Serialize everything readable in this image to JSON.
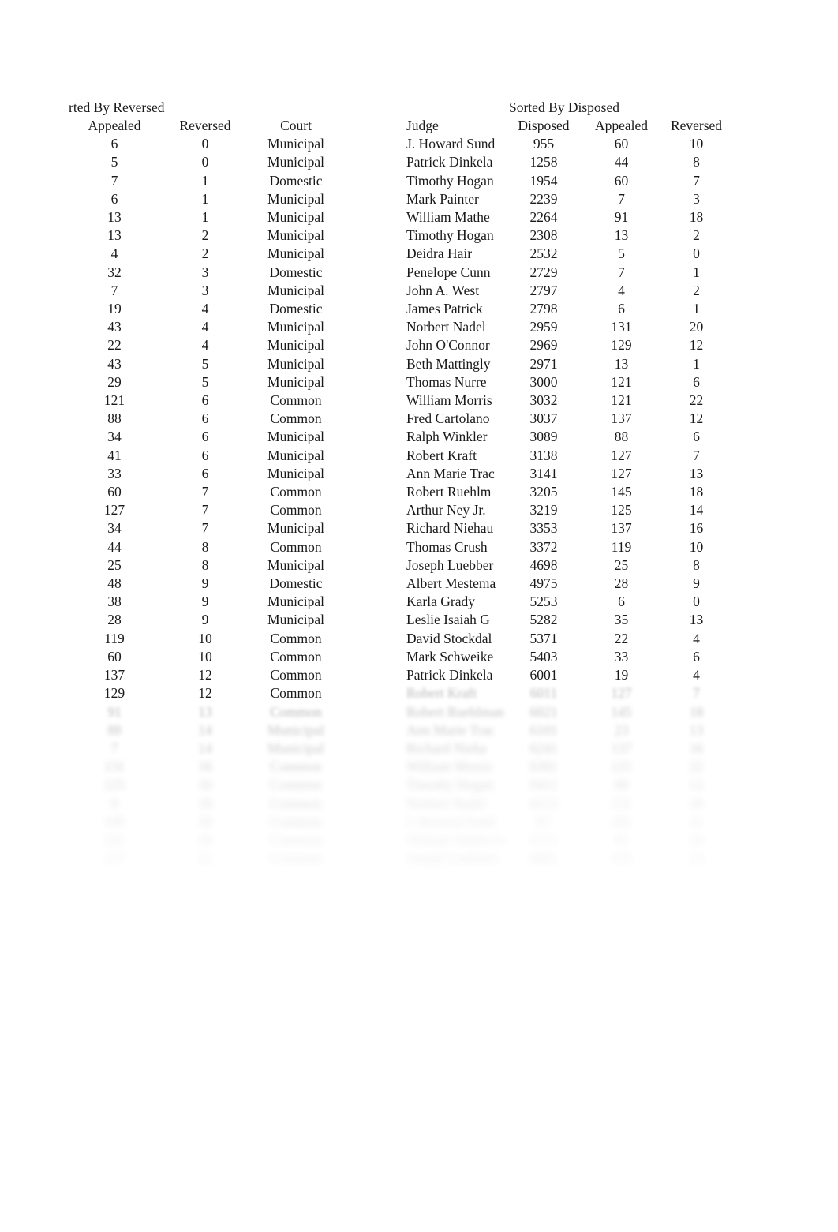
{
  "page": {
    "background_color": "#ffffff",
    "text_color": "#1a1a1a"
  },
  "left_table": {
    "title": "rted By Reversed",
    "columns": [
      "Appealed",
      "Reversed",
      "Court"
    ],
    "rows": [
      [
        "6",
        "0",
        "Municipal"
      ],
      [
        "5",
        "0",
        "Municipal"
      ],
      [
        "7",
        "1",
        "Domestic"
      ],
      [
        "6",
        "1",
        "Municipal"
      ],
      [
        "13",
        "1",
        "Municipal"
      ],
      [
        "13",
        "2",
        "Municipal"
      ],
      [
        "4",
        "2",
        "Municipal"
      ],
      [
        "32",
        "3",
        "Domestic"
      ],
      [
        "7",
        "3",
        "Municipal"
      ],
      [
        "19",
        "4",
        "Domestic"
      ],
      [
        "43",
        "4",
        "Municipal"
      ],
      [
        "22",
        "4",
        "Municipal"
      ],
      [
        "43",
        "5",
        "Municipal"
      ],
      [
        "29",
        "5",
        "Municipal"
      ],
      [
        "121",
        "6",
        "Common"
      ],
      [
        "88",
        "6",
        "Common"
      ],
      [
        "34",
        "6",
        "Municipal"
      ],
      [
        "41",
        "6",
        "Municipal"
      ],
      [
        "33",
        "6",
        "Municipal"
      ],
      [
        "60",
        "7",
        "Common"
      ],
      [
        "127",
        "7",
        "Common"
      ],
      [
        "34",
        "7",
        "Municipal"
      ],
      [
        "44",
        "8",
        "Common"
      ],
      [
        "25",
        "8",
        "Municipal"
      ],
      [
        "48",
        "9",
        "Domestic"
      ],
      [
        "38",
        "9",
        "Municipal"
      ],
      [
        "28",
        "9",
        "Municipal"
      ],
      [
        "119",
        "10",
        "Common"
      ],
      [
        "60",
        "10",
        "Common"
      ],
      [
        "137",
        "12",
        "Common"
      ],
      [
        "129",
        "12",
        "Common"
      ]
    ],
    "faded_rows": [
      [
        "91",
        "13",
        "Common"
      ],
      [
        "88",
        "14",
        "Municipal"
      ],
      [
        "7",
        "14",
        "Municipal"
      ],
      [
        "131",
        "16",
        "Common"
      ],
      [
        "125",
        "16",
        "Common"
      ],
      [
        "9",
        "18",
        "Common"
      ],
      [
        "145",
        "18",
        "Common"
      ],
      [
        "121",
        "20",
        "Common"
      ],
      [
        "137",
        "22",
        "Common"
      ]
    ]
  },
  "right_table": {
    "title": "Sorted By Disposed",
    "columns": [
      "Judge",
      "Disposed",
      "Appealed",
      "Reversed"
    ],
    "rows": [
      [
        "J. Howard Sund",
        "955",
        "60",
        "10"
      ],
      [
        "Patrick Dinkela",
        "1258",
        "44",
        "8"
      ],
      [
        "Timothy Hogan",
        "1954",
        "60",
        "7"
      ],
      [
        "Mark Painter",
        "2239",
        "7",
        "3"
      ],
      [
        "William Mathe",
        "2264",
        "91",
        "18"
      ],
      [
        "Timothy Hogan",
        "2308",
        "13",
        "2"
      ],
      [
        "Deidra Hair",
        "2532",
        "5",
        "0"
      ],
      [
        "Penelope Cunn",
        "2729",
        "7",
        "1"
      ],
      [
        "John A. West",
        "2797",
        "4",
        "2"
      ],
      [
        "James Patrick",
        "2798",
        "6",
        "1"
      ],
      [
        "Norbert Nadel",
        "2959",
        "131",
        "20"
      ],
      [
        "John O'Connor",
        "2969",
        "129",
        "12"
      ],
      [
        "Beth Mattingly",
        "2971",
        "13",
        "1"
      ],
      [
        "Thomas Nurre",
        "3000",
        "121",
        "6"
      ],
      [
        "William Morris",
        "3032",
        "121",
        "22"
      ],
      [
        "Fred Cartolano",
        "3037",
        "137",
        "12"
      ],
      [
        "Ralph Winkler",
        "3089",
        "88",
        "6"
      ],
      [
        "Robert Kraft",
        "3138",
        "127",
        "7"
      ],
      [
        "Ann Marie Trac",
        "3141",
        "127",
        "13"
      ],
      [
        "Robert Ruehlm",
        "3205",
        "145",
        "18"
      ],
      [
        "Arthur Ney Jr.",
        "3219",
        "125",
        "14"
      ],
      [
        "Richard Niehau",
        "3353",
        "137",
        "16"
      ],
      [
        "Thomas Crush",
        "3372",
        "119",
        "10"
      ],
      [
        "Joseph Luebber",
        "4698",
        "25",
        "8"
      ],
      [
        "Albert Mestema",
        "4975",
        "28",
        "9"
      ],
      [
        "Karla Grady",
        "5253",
        "6",
        "0"
      ],
      [
        "Leslie Isaiah G",
        "5282",
        "35",
        "13"
      ],
      [
        "David Stockdal",
        "5371",
        "22",
        "4"
      ],
      [
        "Mark Schweike",
        "5403",
        "33",
        "6"
      ],
      [
        "Patrick Dinkela",
        "6001",
        "19",
        "4"
      ]
    ],
    "faded_rows": [
      [
        "Robert Kraft",
        "6011",
        "127",
        "7"
      ],
      [
        "Robert Ruehlman",
        "6021",
        "145",
        "18"
      ],
      [
        "Ann Marie Trac",
        "6101",
        "23",
        "13"
      ],
      [
        "Richard Nieha",
        "6241",
        "137",
        "16"
      ],
      [
        "William Morris",
        "6301",
        "121",
        "22"
      ],
      [
        "Timothy Hogan",
        "6411",
        "60",
        "12"
      ],
      [
        "Norbert Nadel",
        "6513",
        "131",
        "20"
      ],
      [
        "J. Howard Sund",
        "67",
        "101",
        "11"
      ],
      [
        "William Mathews",
        "6711",
        "91",
        "18"
      ],
      [
        "Joseph Luebbers",
        "6901",
        "125",
        "14"
      ]
    ]
  }
}
